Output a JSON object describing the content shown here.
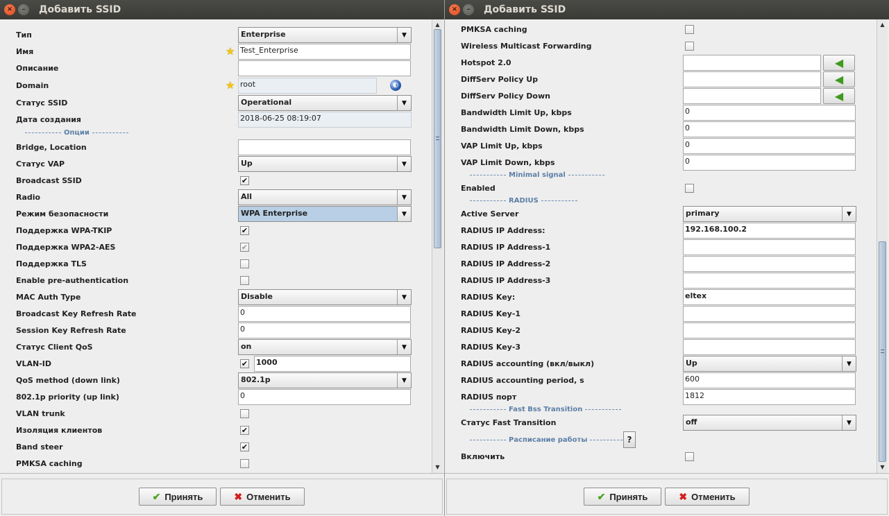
{
  "left": {
    "title": "Добавить SSID",
    "fields": {
      "type": {
        "label": "Тип",
        "value": "Enterprise"
      },
      "name": {
        "label": "Имя",
        "value": "Test_Enterprise"
      },
      "description": {
        "label": "Описание",
        "value": ""
      },
      "domain": {
        "label": "Domain",
        "value": "root"
      },
      "ssid_status": {
        "label": "Статус SSID",
        "value": "Operational"
      },
      "created": {
        "label": "Дата создания",
        "value": "2018-06-25 08:19:07"
      },
      "options_section": "Опции",
      "bridge_location": {
        "label": "Bridge, Location",
        "value": ""
      },
      "vap_status": {
        "label": "Статус VAP",
        "value": "Up"
      },
      "broadcast_ssid": {
        "label": "Broadcast SSID",
        "checked": "✔"
      },
      "radio": {
        "label": "Radio",
        "value": "All"
      },
      "security_mode": {
        "label": "Режим безопасности",
        "value": "WPA Enterprise"
      },
      "wpa_tkip": {
        "label": "Поддержка WPA-TKIP",
        "checked": "✔"
      },
      "wpa2_aes": {
        "label": "Поддержка WPA2-AES",
        "checked": "✔"
      },
      "tls": {
        "label": "Поддержка TLS",
        "checked": ""
      },
      "preauth": {
        "label": "Enable pre-authentication",
        "checked": ""
      },
      "mac_auth": {
        "label": "MAC Auth Type",
        "value": "Disable"
      },
      "bcast_key_refresh": {
        "label": "Broadcast Key Refresh Rate",
        "value": "0"
      },
      "session_key_refresh": {
        "label": "Session Key Refresh Rate",
        "value": "0"
      },
      "client_qos": {
        "label": "Статус Client QoS",
        "value": "on"
      },
      "vlan_id": {
        "label": "VLAN-ID",
        "checked": "✔",
        "value": "1000"
      },
      "qos_method": {
        "label": "QoS method (down link)",
        "value": "802.1p"
      },
      "priority_up": {
        "label": "802.1p priority (up link)",
        "value": "0"
      },
      "vlan_trunk": {
        "label": "VLAN trunk",
        "checked": ""
      },
      "client_isolation": {
        "label": "Изоляция клиентов",
        "checked": "✔"
      },
      "band_steer": {
        "label": "Band steer",
        "checked": "✔"
      },
      "pmksa": {
        "label": "PMKSA caching",
        "checked": ""
      }
    },
    "buttons": {
      "accept": "Принять",
      "cancel": "Отменить"
    }
  },
  "right": {
    "title": "Добавить SSID",
    "fields": {
      "pmksa": {
        "label": "PMKSA caching",
        "checked": ""
      },
      "wmf": {
        "label": "Wireless Multicast Forwarding",
        "checked": ""
      },
      "hotspot": {
        "label": "Hotspot 2.0",
        "value": ""
      },
      "diffserv_up": {
        "label": "DiffServ Policy Up",
        "value": ""
      },
      "diffserv_down": {
        "label": "DiffServ Policy Down",
        "value": ""
      },
      "bw_up": {
        "label": "Bandwidth Limit Up, kbps",
        "value": "0"
      },
      "bw_down": {
        "label": "Bandwidth Limit Down, kbps",
        "value": "0"
      },
      "vap_up": {
        "label": "VAP Limit Up, kbps",
        "value": "0"
      },
      "vap_down": {
        "label": "VAP Limit Down, kbps",
        "value": "0"
      },
      "minimal_signal_section": "Minimal signal",
      "enabled": {
        "label": "Enabled",
        "checked": ""
      },
      "radius_section": "RADIUS",
      "active_server": {
        "label": "Active Server",
        "value": "primary"
      },
      "radius_ip": {
        "label": "RADIUS IP Address:",
        "value": "192.168.100.2"
      },
      "radius_ip1": {
        "label": "RADIUS IP Address-1",
        "value": ""
      },
      "radius_ip2": {
        "label": "RADIUS IP Address-2",
        "value": ""
      },
      "radius_ip3": {
        "label": "RADIUS IP Address-3",
        "value": ""
      },
      "radius_key": {
        "label": "RADIUS Key:",
        "value": "eltex"
      },
      "radius_key1": {
        "label": "RADIUS Key-1",
        "value": ""
      },
      "radius_key2": {
        "label": "RADIUS Key-2",
        "value": ""
      },
      "radius_key3": {
        "label": "RADIUS Key-3",
        "value": ""
      },
      "radius_accounting": {
        "label": "RADIUS accounting (вкл/выкл)",
        "value": "Up"
      },
      "radius_acct_period": {
        "label": "RADIUS accounting period, s",
        "value": "600"
      },
      "radius_port": {
        "label": "RADIUS порт",
        "value": "1812"
      },
      "fbt_section": "Fast Bss Transition",
      "fast_transition": {
        "label": "Статус Fast Transition",
        "value": "off"
      },
      "schedule_section": "Расписание работы",
      "help": "?",
      "enable": {
        "label": "Включить",
        "checked": ""
      }
    },
    "buttons": {
      "accept": "Принять",
      "cancel": "Отменить"
    }
  },
  "icons": {
    "accept": "check-icon",
    "cancel": "cross-icon",
    "required": "star-icon",
    "domain_picker": "globe-icon",
    "clear": "arrow-left-icon"
  },
  "colors": {
    "section_text": "#5d7fa6",
    "selected_combo": "#b8cfe5",
    "accept_icon": "#4aa31f",
    "cancel_icon": "#d21e1e"
  }
}
